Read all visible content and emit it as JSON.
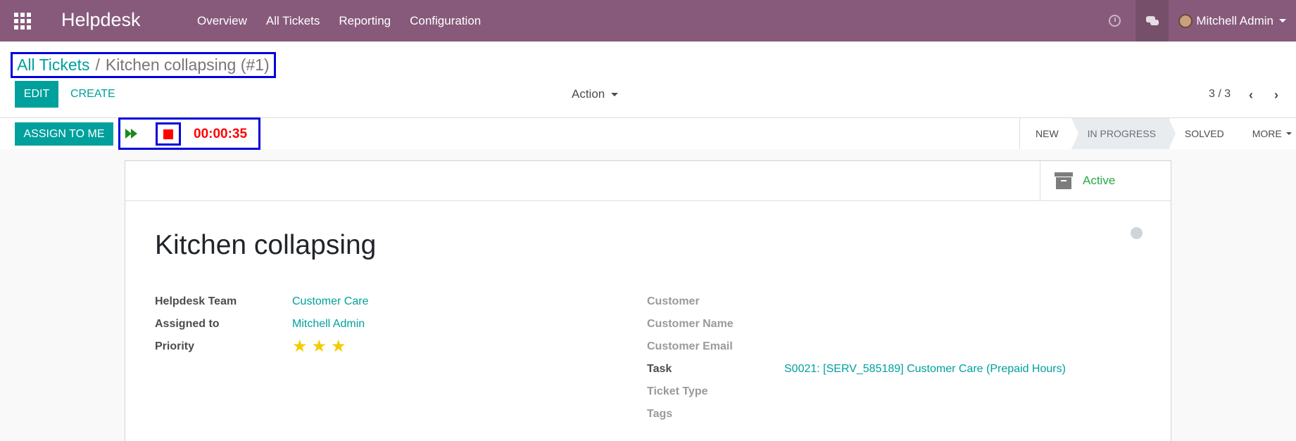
{
  "navbar": {
    "brand": "Helpdesk",
    "menu": [
      "Overview",
      "All Tickets",
      "Reporting",
      "Configuration"
    ],
    "user_name": "Mitchell Admin"
  },
  "breadcrumb": {
    "parent": "All Tickets",
    "separator": "/",
    "current": "Kitchen collapsing (#1)"
  },
  "toolbar": {
    "edit_label": "EDIT",
    "create_label": "CREATE",
    "action_label": "Action",
    "pager": "3 / 3"
  },
  "statusbar": {
    "assign_label": "ASSIGN TO ME",
    "timer": "00:00:35",
    "stages": [
      "NEW",
      "IN PROGRESS",
      "SOLVED"
    ],
    "active_stage": "IN PROGRESS",
    "more_label": "MORE"
  },
  "sheet": {
    "active_label": "Active",
    "title": "Kitchen collapsing",
    "left_fields": [
      {
        "label": "Helpdesk Team",
        "value": "Customer Care"
      },
      {
        "label": "Assigned to",
        "value": "Mitchell Admin"
      },
      {
        "label": "Priority",
        "stars": 3
      }
    ],
    "right_fields": [
      {
        "label": "Customer",
        "value": ""
      },
      {
        "label": "Customer Name",
        "value": ""
      },
      {
        "label": "Customer Email",
        "value": ""
      },
      {
        "label": "Task",
        "value": "S0021: [SERV_585189] Customer Care (Prepaid Hours)"
      },
      {
        "label": "Ticket Type",
        "value": ""
      },
      {
        "label": "Tags",
        "value": ""
      }
    ]
  },
  "colors": {
    "navbar": "#875a7b",
    "accent": "#00a09d",
    "timer": "#ff0000",
    "active": "#28a745",
    "star": "#f3cc00"
  },
  "icons": [
    "apps-icon",
    "clock-icon",
    "chat-icon",
    "fast-forward-icon",
    "stop-icon",
    "chevron-left-icon",
    "chevron-right-icon",
    "archive-icon",
    "star-icon"
  ]
}
